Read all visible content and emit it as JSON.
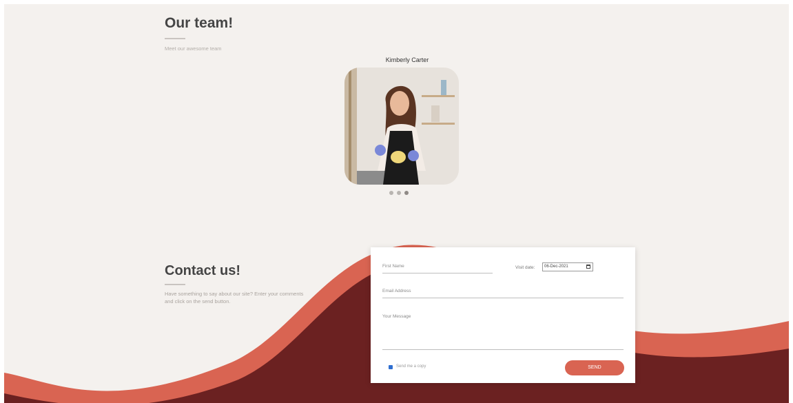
{
  "team": {
    "title": "Our team!",
    "subtitle": "Meet our awesome team",
    "member": {
      "name": "Kimberly Carter",
      "photo_icon": "portrait-photo"
    },
    "carousel_dots": 3,
    "active_dot": 2
  },
  "contact": {
    "title": "Contact us!",
    "description": "Have something to say about our site? Enter your comments and click on the send button.",
    "form": {
      "first_name_placeholder": "First Name",
      "visit_date_label": "Visit date:",
      "visit_date_value": "06-Dec-2021",
      "email_placeholder": "Email Address",
      "message_placeholder": "Your Message",
      "checkbox_label": "Send me a copy",
      "checkbox_checked": true,
      "send_label": "SEND"
    }
  },
  "colors": {
    "background": "#f4f1ee",
    "wave_light": "#d96452",
    "wave_dark": "#6b2121",
    "button": "#d96452"
  }
}
